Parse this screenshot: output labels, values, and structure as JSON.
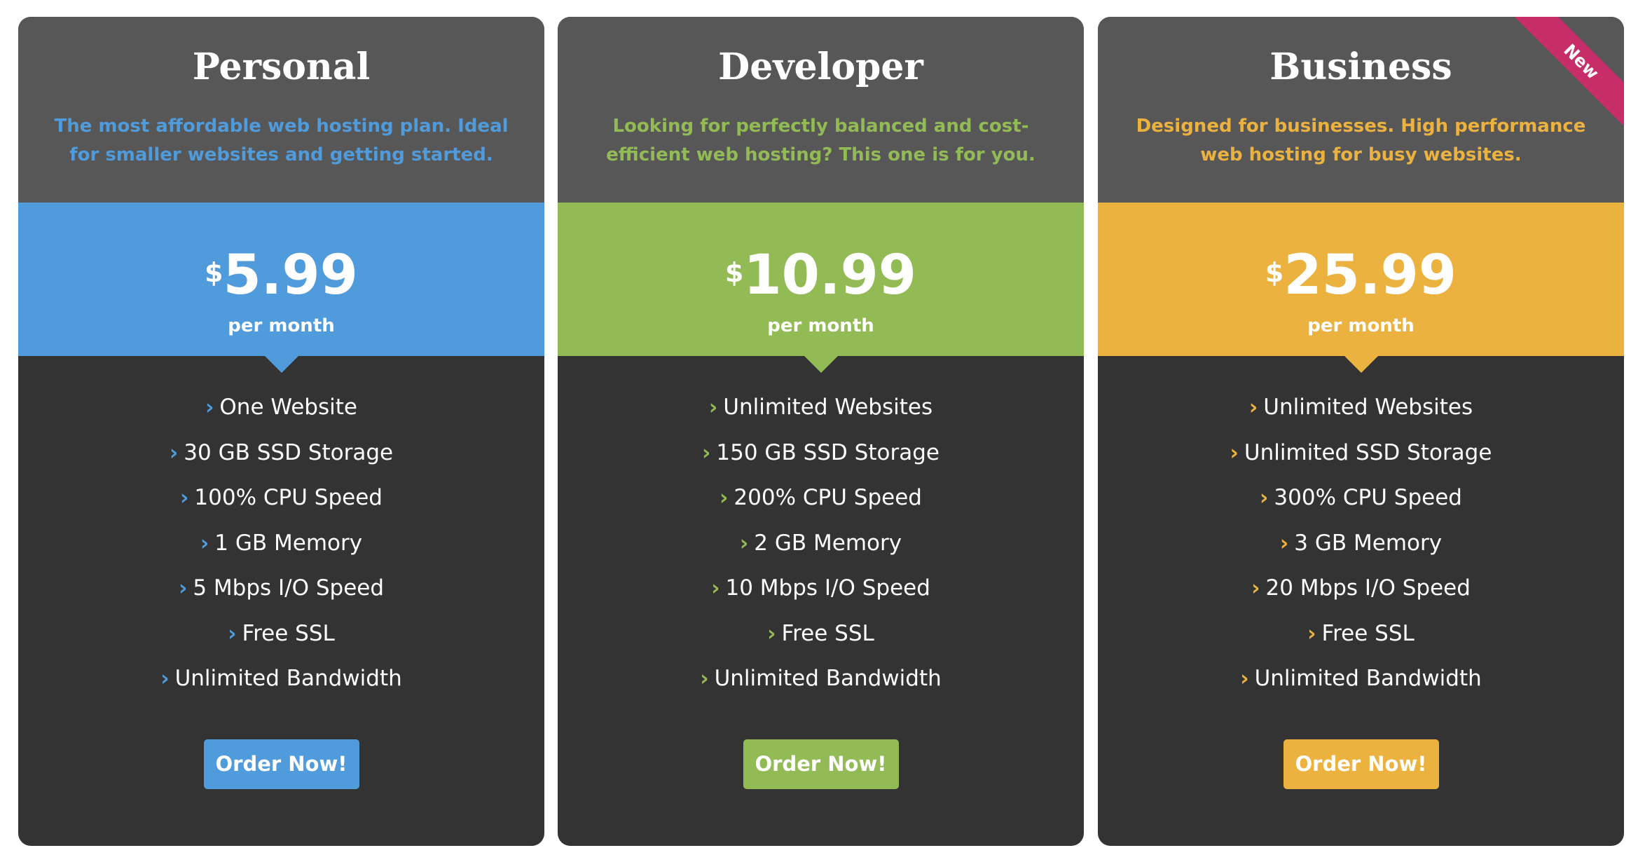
{
  "plans": [
    {
      "name": "Personal",
      "description": "The most affordable web hosting plan. Ideal for smaller websites and getting started.",
      "currency": "$",
      "price": "5.99",
      "period": "per month",
      "accent_color": "#4f9bdb",
      "features": [
        "One Website",
        "30 GB SSD Storage",
        "100% CPU Speed",
        "1 GB Memory",
        "5 Mbps I/O Speed",
        "Free SSL",
        "Unlimited Bandwidth"
      ],
      "button_label": "Order Now!"
    },
    {
      "name": "Developer",
      "description": "Looking for perfectly balanced and cost-efficient web hosting? This one is for you.",
      "currency": "$",
      "price": "10.99",
      "period": "per month",
      "accent_color": "#93bb55",
      "features": [
        "Unlimited Websites",
        "150 GB SSD Storage",
        "200% CPU Speed",
        "2 GB Memory",
        "10 Mbps I/O Speed",
        "Free SSL",
        "Unlimited Bandwidth"
      ],
      "button_label": "Order Now!"
    },
    {
      "name": "Business",
      "description": "Designed for businesses. High performance web hosting for busy websites.",
      "currency": "$",
      "price": "25.99",
      "period": "per month",
      "accent_color": "#ebb23f",
      "features": [
        "Unlimited Websites",
        "Unlimited SSD Storage",
        "300% CPU Speed",
        "3 GB Memory",
        "20 Mbps I/O Speed",
        "Free SSL",
        "Unlimited Bandwidth"
      ],
      "button_label": "Order Now!",
      "ribbon_label": "New",
      "ribbon_color": "#c72d68"
    }
  ],
  "icons": {
    "feature_bullet": "chevron-right-icon",
    "feature_bullet_glyph": "›"
  },
  "colors": {
    "card_header": "#575757",
    "card_body": "#333333",
    "text": "#ffffff"
  }
}
